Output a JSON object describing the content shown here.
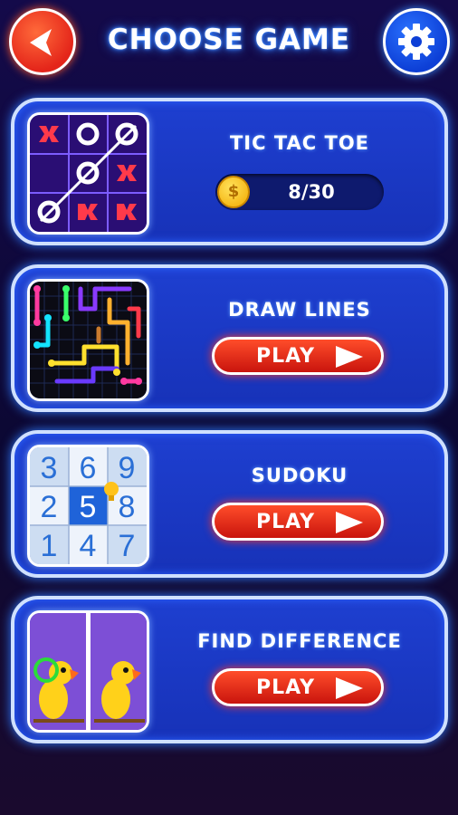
{
  "header": {
    "title": "CHOOSE GAME",
    "back_icon": "arrow-left-icon",
    "settings_icon": "gear-icon"
  },
  "games": [
    {
      "name": "TIC TAC TOE",
      "progress": "8/30",
      "coin_symbol": "$"
    },
    {
      "name": "DRAW LINES",
      "play_label": "PLAY"
    },
    {
      "name": "SUDOKU",
      "play_label": "PLAY",
      "digits": [
        "3",
        "6",
        "9",
        "2",
        "5",
        "8",
        "1",
        "4",
        "7"
      ]
    },
    {
      "name": "FIND DIFFERENCE",
      "play_label": "PLAY"
    }
  ],
  "colors": {
    "accent_blue": "#1e3fd0",
    "play_red": "#e4251a",
    "glow": "#2f7bff"
  }
}
